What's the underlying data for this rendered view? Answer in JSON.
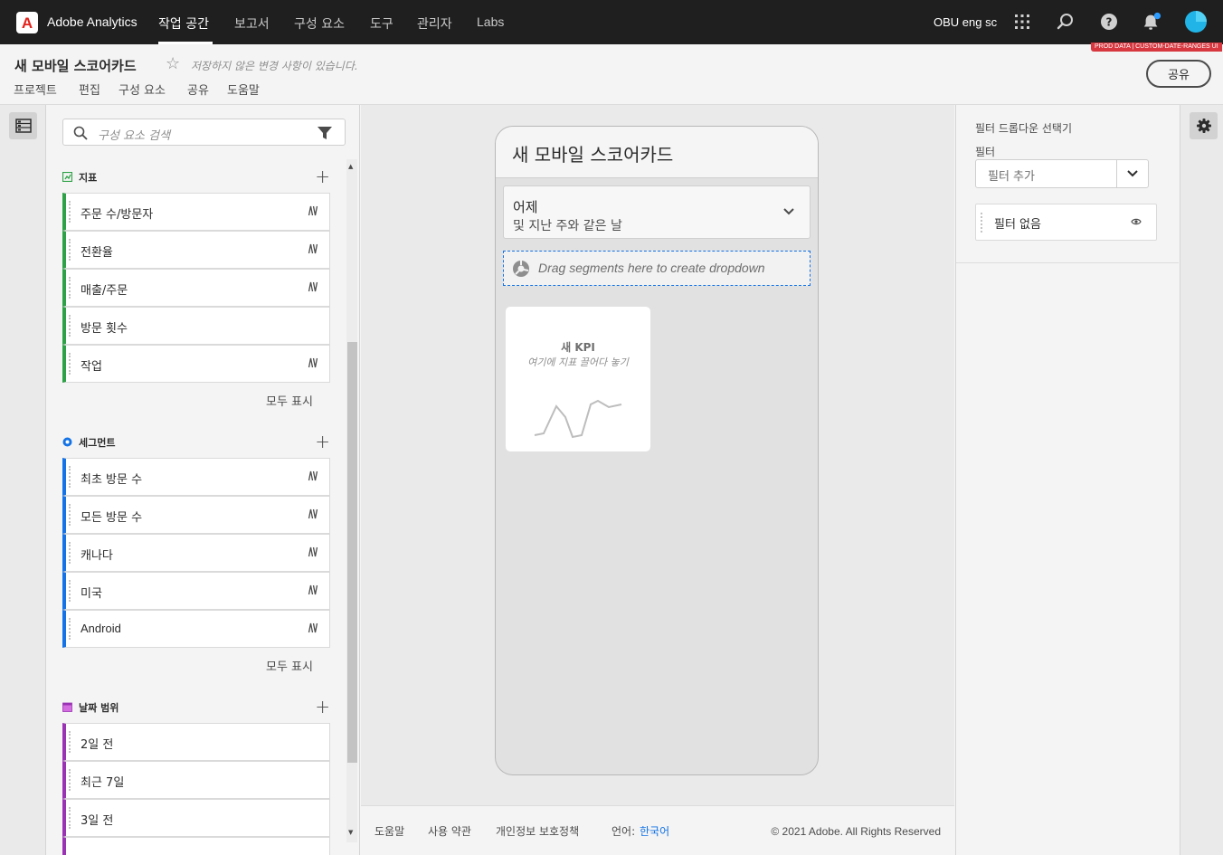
{
  "topnav": {
    "app_name": "Adobe Analytics",
    "items": [
      "작업 공간",
      "보고서",
      "구성 요소",
      "도구",
      "관리자",
      "Labs"
    ],
    "org": "OBU eng sc",
    "badge": "PROD DATA | CUSTOM-DATE-RANGES UI"
  },
  "project": {
    "title": "새 모바일 스코어카드",
    "unsaved": "저장하지 않은 변경 사항이 있습니다.",
    "menu": [
      "프로젝트",
      "편집",
      "구성 요소",
      "공유",
      "도움말"
    ],
    "share": "공유"
  },
  "components": {
    "search_placeholder": "구성 요소 검색",
    "metrics": {
      "label": "지표",
      "color": "#2da146",
      "items": [
        "주문 수/방문자",
        "전환율",
        "매출/주문",
        "방문 횟수",
        "작업"
      ],
      "show_all": "모두 표시"
    },
    "segments": {
      "label": "세그먼트",
      "color": "#1473e6",
      "items": [
        "최초 방문 수",
        "모든 방문 수",
        "캐나다",
        "미국",
        "Android"
      ],
      "show_all": "모두 표시"
    },
    "date_ranges": {
      "label": "날짜 범위",
      "color": "#9a33b3",
      "items": [
        "2일 전",
        "최근 7일",
        "3일 전"
      ]
    }
  },
  "scorecard": {
    "title": "새 모바일 스코어카드",
    "date_main": "어제",
    "date_sub": "및 지난 주와 같은 날",
    "segment_drop": "Drag segments here to create dropdown",
    "kpi_title": "새 KPI",
    "kpi_sub": "여기에 지표 끌어다 놓기"
  },
  "footer": {
    "help": "도움말",
    "terms": "사용 약관",
    "privacy": "개인정보 보호정책",
    "language_label": "언어:",
    "language": "한국어",
    "copyright": "© 2021 Adobe. All Rights Reserved"
  },
  "filter_panel": {
    "title": "필터 드롭다운 선택기",
    "filter_label": "필터",
    "add_placeholder": "필터 추가",
    "no_filter": "필터 없음"
  }
}
